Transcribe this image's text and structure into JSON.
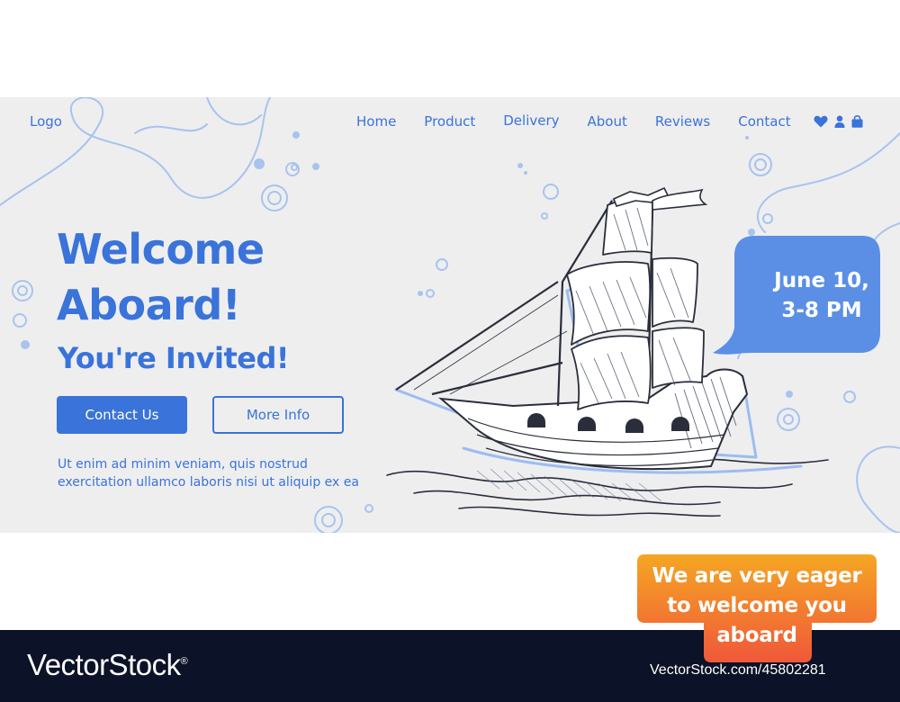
{
  "header": {
    "logo": "Logo",
    "nav": [
      "Home",
      "Product",
      "Delivery",
      "About",
      "Reviews",
      "Contact"
    ],
    "icons": [
      "heart-icon",
      "user-icon",
      "shopping-bag-icon"
    ]
  },
  "hero": {
    "title_line1": "Welcome",
    "title_line2": "Aboard!",
    "subtitle": "You're Invited!",
    "primary_button": "Contact Us",
    "secondary_button": "More Info",
    "body": "Ut enim ad minim veniam, quis nostrud exercitation ullamco laboris nisi ut aliquip ex ea"
  },
  "event_bubble": {
    "text": "June 10,\n3-8 PM"
  },
  "promo_badge": {
    "text": "We are very eager\nto welcome you\naboard"
  },
  "footer": {
    "brand": "VectorStock",
    "trademark": "®",
    "image_id": "VectorStock.com/45802281"
  },
  "colors": {
    "accent": "#3a73d9",
    "banner_background": "#eeeeef",
    "bubble": "#5b8fe6",
    "footer_background": "#0c1227",
    "promo_gradient_top": "#f5a623",
    "promo_gradient_bottom": "#f0583a"
  }
}
